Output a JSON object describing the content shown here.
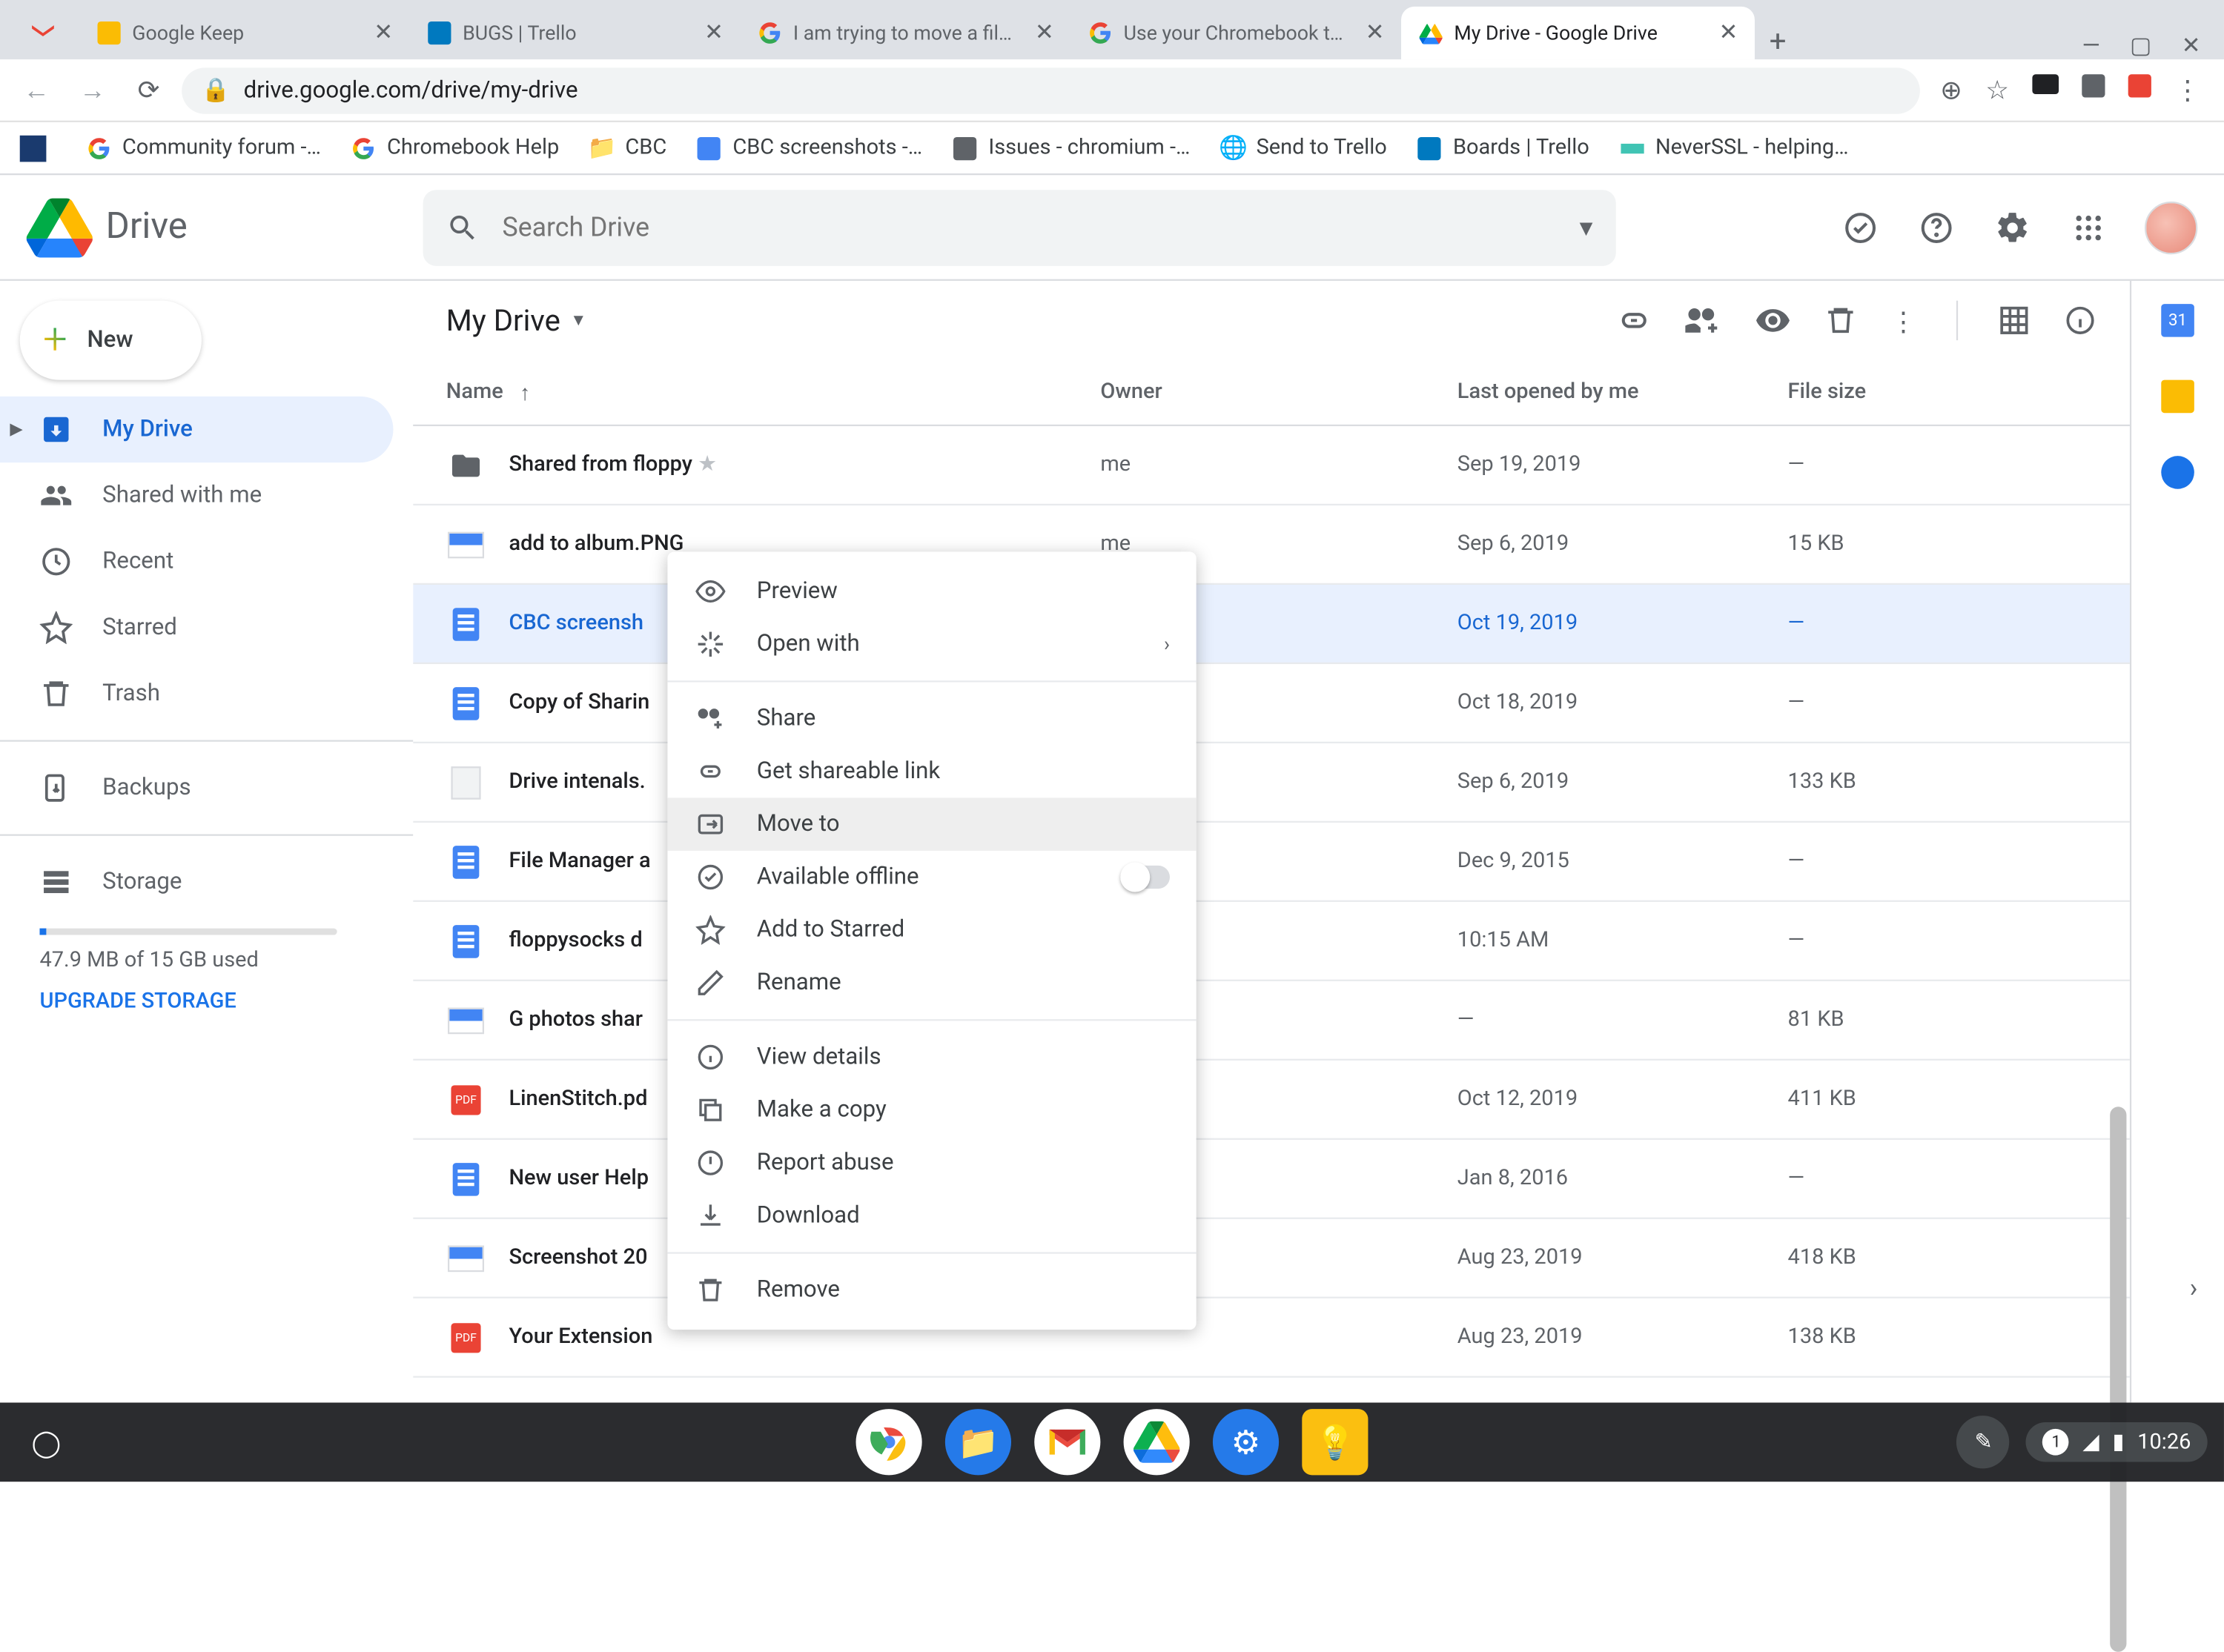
{
  "browser": {
    "tabs": [
      {
        "title": "",
        "favicon": "gmail"
      },
      {
        "title": "Google Keep",
        "favicon": "keep",
        "close": true
      },
      {
        "title": "BUGS | Trello",
        "favicon": "trello",
        "close": true
      },
      {
        "title": "I am trying to move a file fron",
        "favicon": "google",
        "close": true
      },
      {
        "title": "Use your Chromebook touchp",
        "favicon": "google",
        "close": true
      },
      {
        "title": "My Drive - Google Drive",
        "favicon": "drive",
        "close": true,
        "active": true
      }
    ],
    "url": "drive.google.com/drive/my-drive",
    "bookmarks": [
      {
        "label": "",
        "icon": "weather"
      },
      {
        "label": "Community forum -…",
        "icon": "google"
      },
      {
        "label": "Chromebook Help",
        "icon": "google"
      },
      {
        "label": "CBC",
        "icon": "folder"
      },
      {
        "label": "CBC screenshots -…",
        "icon": "docs"
      },
      {
        "label": "Issues - chromium -…",
        "icon": "chromium"
      },
      {
        "label": "Send to Trello",
        "icon": "globe"
      },
      {
        "label": "Boards | Trello",
        "icon": "trello"
      },
      {
        "label": "NeverSSL - helping…",
        "icon": "neverssl"
      }
    ]
  },
  "drive": {
    "brand": "Drive",
    "search_placeholder": "Search Drive",
    "new_label": "New",
    "nav": {
      "mydrive": "My Drive",
      "shared": "Shared with me",
      "recent": "Recent",
      "starred": "Starred",
      "trash": "Trash",
      "backups": "Backups",
      "storage": "Storage",
      "storage_text": "47.9 MB of 15 GB used",
      "upgrade": "UPGRADE STORAGE"
    },
    "path_title": "My Drive",
    "columns": {
      "name": "Name",
      "owner": "Owner",
      "date": "Last opened by me",
      "size": "File size"
    },
    "files": [
      {
        "name": "Shared from floppy",
        "owner": "me",
        "date": "Sep 19, 2019",
        "size": "—",
        "type": "folder",
        "star": true
      },
      {
        "name": "add to album.PNG",
        "owner": "me",
        "date": "Sep 6, 2019",
        "size": "15 KB",
        "type": "image"
      },
      {
        "name": "CBC screensh",
        "owner": "",
        "date": "Oct 19, 2019",
        "size": "—",
        "type": "docs",
        "selected": true
      },
      {
        "name": "Copy of Sharin",
        "owner": "",
        "date": "Oct 18, 2019",
        "size": "—",
        "type": "docs"
      },
      {
        "name": "Drive intenals.",
        "owner": "",
        "date": "Sep 6, 2019",
        "size": "133 KB",
        "type": "text"
      },
      {
        "name": "File Manager a",
        "owner": "",
        "date": "Dec 9, 2015",
        "size": "—",
        "type": "docs"
      },
      {
        "name": "floppysocks d",
        "owner": "",
        "date": "10:15 AM",
        "size": "—",
        "type": "docs"
      },
      {
        "name": "G photos shar",
        "owner": "",
        "date": "—",
        "size": "81 KB",
        "type": "image"
      },
      {
        "name": "LinenStitch.pd",
        "owner": "",
        "date": "Oct 12, 2019",
        "size": "411 KB",
        "type": "pdf"
      },
      {
        "name": "New user Help",
        "owner": "",
        "date": "Jan 8, 2016",
        "size": "—",
        "type": "docs"
      },
      {
        "name": "Screenshot 20",
        "owner": "",
        "date": "Aug 23, 2019",
        "size": "418 KB",
        "type": "image"
      },
      {
        "name": "Your Extension",
        "owner": "",
        "date": "Aug 23, 2019",
        "size": "138 KB",
        "type": "pdf"
      }
    ],
    "context_menu": [
      {
        "label": "Preview",
        "icon": "eye"
      },
      {
        "label": "Open with",
        "icon": "openwith",
        "arrow": true
      },
      {
        "divider": true
      },
      {
        "label": "Share",
        "icon": "share"
      },
      {
        "label": "Get shareable link",
        "icon": "link"
      },
      {
        "label": "Move to",
        "icon": "moveto",
        "highlight": true
      },
      {
        "label": "Available offline",
        "icon": "offline",
        "toggle": true
      },
      {
        "label": "Add to Starred",
        "icon": "star"
      },
      {
        "label": "Rename",
        "icon": "rename"
      },
      {
        "divider": true
      },
      {
        "label": "View details",
        "icon": "info"
      },
      {
        "label": "Make a copy",
        "icon": "copy"
      },
      {
        "label": "Report abuse",
        "icon": "abuse"
      },
      {
        "label": "Download",
        "icon": "download"
      },
      {
        "divider": true
      },
      {
        "label": "Remove",
        "icon": "trash"
      }
    ]
  },
  "shelf": {
    "time": "10:26",
    "notif_count": "1"
  }
}
